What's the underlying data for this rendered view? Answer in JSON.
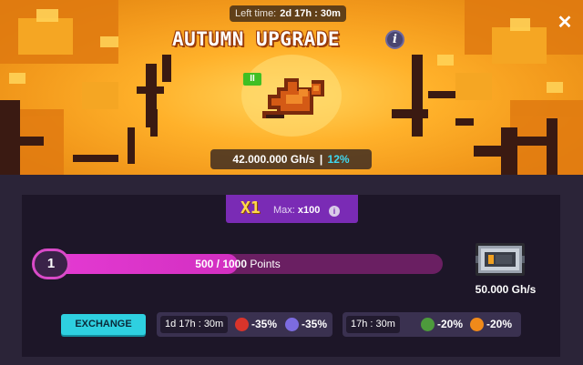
{
  "header": {
    "left_time_label": "Left time:",
    "left_time_value": "2d 17h : 30m",
    "title": "AUTUMN UPGRADE",
    "info_icon": "info-icon",
    "close_icon": "close-icon"
  },
  "hero": {
    "level_badge": "II",
    "item_icon": "autumn-leaf-icon",
    "power": "42.000.000 Gh/s",
    "power_separator": "|",
    "power_percent": "12%"
  },
  "multiplier": {
    "current": "X1",
    "max_label": "Max:",
    "max_value": "x100"
  },
  "progress": {
    "level": "1",
    "current": "500",
    "separator": " / ",
    "total": "1000",
    "unit": "Points",
    "fraction": 0.5
  },
  "reward": {
    "icon": "miner-case-icon",
    "value": "50.000 Gh/s"
  },
  "exchange": {
    "label": "EXCHANGE"
  },
  "boosts": [
    {
      "timer": "1d 17h : 30m",
      "items": [
        {
          "icon": "tron-coin-icon",
          "percent": "-35%",
          "color": "#d9342b"
        },
        {
          "icon": "ethereum-coin-icon",
          "percent": "-35%",
          "color": "#7c6ce0"
        }
      ]
    },
    {
      "timer": "17h : 30m",
      "items": [
        {
          "icon": "frog-coin-icon",
          "percent": "-20%",
          "color": "#4d9a3c"
        },
        {
          "icon": "shiba-coin-icon",
          "percent": "-20%",
          "color": "#f08a1a"
        }
      ]
    }
  ],
  "colors": {
    "accent_pink": "#d22fc1",
    "accent_purple": "#7a2bb5",
    "exchange_cyan": "#2ed0e0",
    "percent_cyan": "#3fd8f0"
  }
}
